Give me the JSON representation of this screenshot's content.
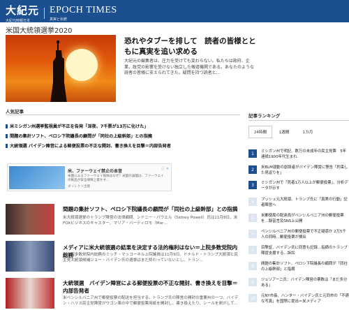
{
  "header": {
    "logo_cn": "大紀元",
    "logo_cn_sub": "大紀元時報日本",
    "logo_en": "EPOCH TIMES",
    "logo_en_sub": "真実と伝統"
  },
  "section_title": "米国大統領選挙2020",
  "hero": {
    "title": "恐れやタブーを排して　読者の皆様とともに真実を追い求める",
    "body": "大紀元の編集者は、圧力を受けても変わらない。私たちは政府、企業、政党の影響を受けない独立した報道機関である。あなたのような読者の皆様に支えられてきた。疑問を持つ読者と…"
  },
  "news_heading": "人気記事",
  "bullets": [
    "米ミシガン州選挙監視員が不正を告発「深夜、7千票が13万に化けた」",
    "間題の集計ソフト、ペロシ下院議長の顧問が「同社の上級幹部」との指摘",
    "大統領選 バイデン陣営による郵便投票の不正な開封、書き換えを目撃＝内部告発者"
  ],
  "ad": {
    "title": "米、ファーウェイ禁止の本音",
    "desc": "米国によるファーウェイ排除はなぜ？米国の論理は、ファーウェイの製品が安全保障上脅かす…",
    "source": "ダイレクト出版",
    "badge": "ⓘ ✕"
  },
  "articles": [
    {
      "title": "間題の集計ソフト、ペロシ下院議長の顧問が「同社の上級幹部」との指摘",
      "desc": "米大統領選挙のトランプ陣営の法律顧問、シドニー・パウエル（Sidney Powell）氏は11月8日、米FOXビジネスのキャスター、マリア・バーティロモ（Mar…"
    },
    {
      "title": "メディアに米大統領選の結果を決定する法的権利はない＝上院多数党院内総務",
      "desc": "米上院多数党院内総務のミッチ・マッコーネル上院議員は11月9日、ドナルド・トランプ大統領と民主党大統領候補ジョー・バイデン氏の選挙はまだ終わっていないとし、トラン…"
    },
    {
      "title": "大統領選　バイデン陣営による郵便投票の不正な開封、書き換えを目撃＝内部告発者",
      "desc": "米ペンシルバニア州で郵便投票の配送を担当する、トランプ氏の陣営の開封の重要州の一つ、バイデン・ハリス民主党陣営がワゴン車の中で郵便投票用紙を開封し、書き換えたり、シールを剥がして…"
    }
  ],
  "ranking": {
    "heading": "記事ランキング",
    "tabs": [
      "24時間",
      "1週間",
      "1カ月"
    ],
    "items": [
      {
        "num": "1",
        "text": "ミシガン州で明記、数万の未成年の民主党票　5年連続1900年代生まれ"
      },
      {
        "num": "2",
        "text": "米BLM運動の創設者がバイデン陣営に警告「約束した見返りを」"
      },
      {
        "num": "3",
        "text": "ミシガン州で「死者1万人以上が郵便投票」、分析データが示す"
      },
      {
        "num": "4",
        "text": "プッシュ元大統領、トランプ氏に「真実の行動」記者陣営へ"
      },
      {
        "num": "5",
        "text": "米郵便局の配達員がペンシルベニア州の郵便投票を…録音言及SNS上公開"
      },
      {
        "num": "6",
        "text": "ペンシルベニア州の郵便投票で不正疑惑か 2万5千人の同時…郵便投票が検出"
      },
      {
        "num": "7",
        "text": "目撃証、バイデン氏に同意も記録…指摘のトランプ陣営支援する…訴訟"
      },
      {
        "num": "8",
        "text": "間題の集計ソフト、ペロシ下院議長の顧問が「同社の上級幹部」と指摘"
      },
      {
        "num": "9",
        "text": "ジュリアーニ氏：バイデン陣営の票数は「まだ多分ある」"
      },
      {
        "num": "10",
        "text": "元NY市長、ハンター・バイデン氏と元同市の「不適な写真」を国際に提出＝米メディア"
      }
    ]
  },
  "colors": {
    "brand": "#1b4f8f",
    "rank_top": "#1b4f8f",
    "rank_rest": "#dde5f0"
  }
}
